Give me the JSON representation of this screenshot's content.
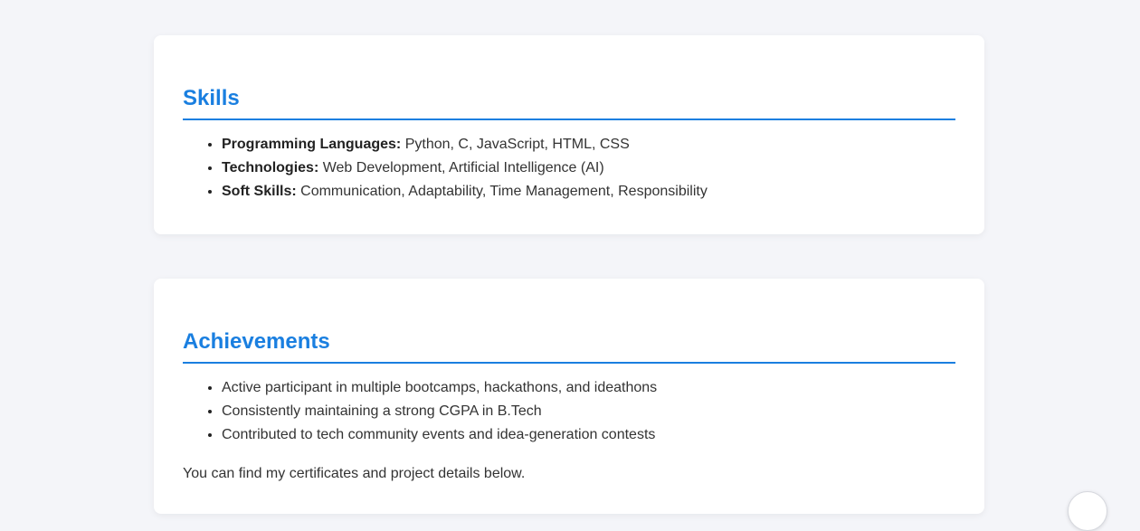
{
  "skills": {
    "title": "Skills",
    "items": [
      {
        "label": "Programming Languages:",
        "value": " Python, C, JavaScript, HTML, CSS"
      },
      {
        "label": "Technologies:",
        "value": " Web Development, Artificial Intelligence (AI)"
      },
      {
        "label": "Soft Skills:",
        "value": " Communication, Adaptability, Time Management, Responsibility"
      }
    ]
  },
  "achievements": {
    "title": "Achievements",
    "items": [
      "Active participant in multiple bootcamps, hackathons, and ideathons",
      "Consistently maintaining a strong CGPA in B.Tech",
      "Contributed to tech community events and idea-generation contests"
    ],
    "note": "You can find my certificates and project details below."
  },
  "colors": {
    "accent": "#1a7fe0",
    "background": "#f4f5f9",
    "card": "#ffffff",
    "text": "#333333"
  }
}
